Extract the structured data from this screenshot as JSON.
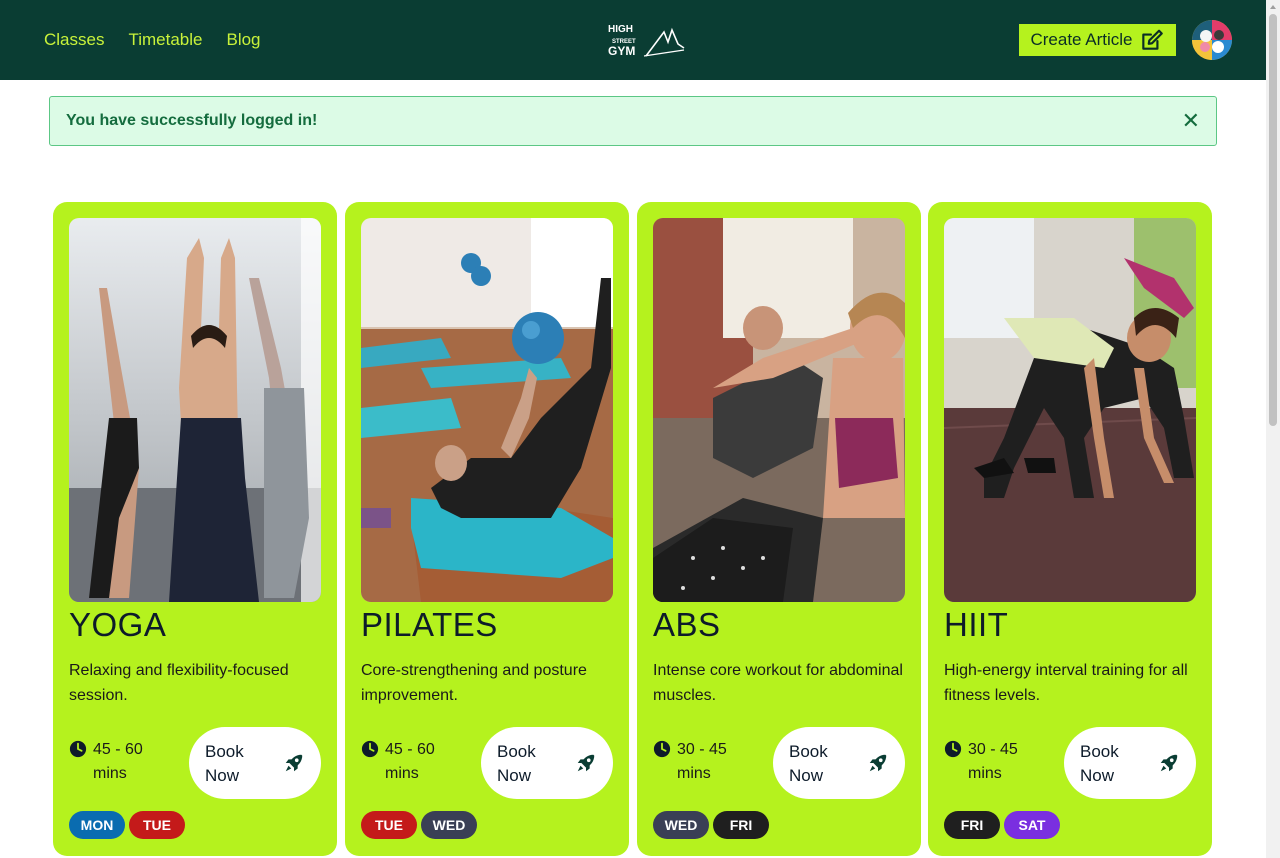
{
  "nav": {
    "links": [
      "Classes",
      "Timetable",
      "Blog"
    ]
  },
  "logo": {
    "line1": "HIGH",
    "line2": "STREET",
    "line3": "GYM"
  },
  "header": {
    "create_article_label": "Create Article"
  },
  "alert": {
    "message": "You have successfully logged in!",
    "close_glyph": "✕"
  },
  "colors": {
    "header_bg": "#0a3d33",
    "accent": "#b5f21e",
    "nav_text": "#c8f23a",
    "alert_bg": "#dcfbe6",
    "day_mon": "#0a6cb0",
    "day_tue": "#c41a1a",
    "day_wed": "#3a3f55",
    "day_fri": "#1f1f1f",
    "day_sat": "#7a2fe0"
  },
  "classes": [
    {
      "title": "YOGA",
      "description": "Relaxing and flexibility-focused session.",
      "duration": "45 - 60 mins",
      "book_label": "Book Now",
      "days": [
        {
          "label": "MON",
          "color": "#0a6cb0"
        },
        {
          "label": "TUE",
          "color": "#c41a1a"
        }
      ],
      "image_icon": "yoga-photo"
    },
    {
      "title": "PILATES",
      "description": "Core-strengthening and posture improvement.",
      "duration": "45 - 60 mins",
      "book_label": "Book Now",
      "days": [
        {
          "label": "TUE",
          "color": "#c41a1a"
        },
        {
          "label": "WED",
          "color": "#3a3f55"
        }
      ],
      "image_icon": "pilates-photo"
    },
    {
      "title": "ABS",
      "description": "Intense core workout for abdominal muscles.",
      "duration": "30 - 45 mins",
      "book_label": "Book Now",
      "days": [
        {
          "label": "WED",
          "color": "#3a3f55"
        },
        {
          "label": "FRI",
          "color": "#1f1f1f"
        }
      ],
      "image_icon": "abs-photo"
    },
    {
      "title": "HIIT",
      "description": "High-energy interval training for all fitness levels.",
      "duration": "30 - 45 mins",
      "book_label": "Book Now",
      "days": [
        {
          "label": "FRI",
          "color": "#1f1f1f"
        },
        {
          "label": "SAT",
          "color": "#7a2fe0"
        }
      ],
      "image_icon": "hiit-photo"
    }
  ]
}
